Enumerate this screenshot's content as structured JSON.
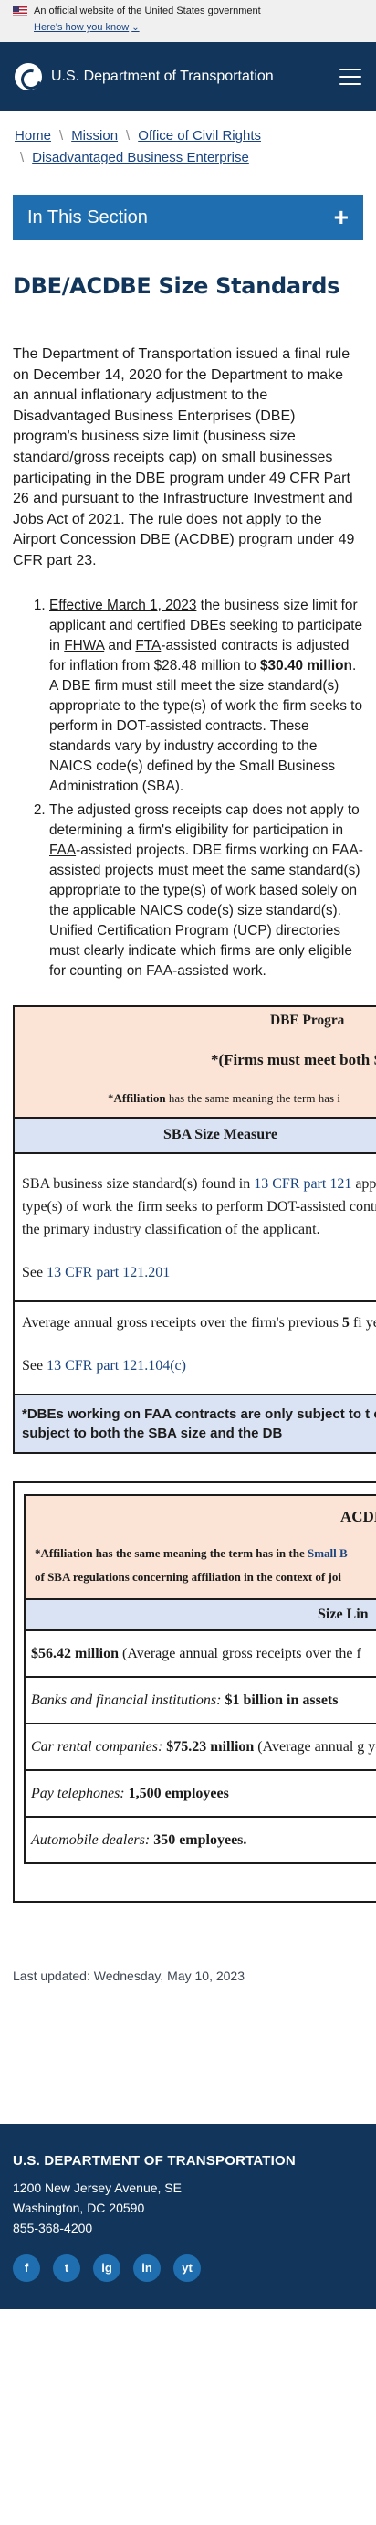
{
  "gov_banner": {
    "text": "An official website of the United States government",
    "link": "Here's how you know"
  },
  "header": {
    "agency": "U.S. Department of Transportation"
  },
  "breadcrumb": {
    "items": [
      "Home",
      "Mission",
      "Office of Civil Rights",
      "Disadvantaged Business Enterprise"
    ]
  },
  "section_nav": {
    "label": "In This Section",
    "toggle": "+"
  },
  "page": {
    "title": "DBE/ACDBE Size Standards",
    "intro": "The Department of Transportation issued a final rule on December 14, 2020 for the Department to make an annual inflationary adjustment to the Disadvantaged Business Enterprises (DBE) program's business size limit (business size standard/gross receipts cap) on small businesses participating in the DBE program under 49 CFR Part 26 and pursuant to the Infrastructure Investment and Jobs Act of 2021. The rule does not apply to the Airport Concession DBE (ACDBE) program under 49 CFR part 23."
  },
  "rules": {
    "item1": {
      "date_link": "Effective March 1, 2023",
      "t1": " the business size limit for applicant and certified DBEs seeking to participate in ",
      "fhwa": "FHWA",
      "t2": " and ",
      "fta": "FTA",
      "t3": "-assisted contracts is adjusted for inflation from $28.48 million to ",
      "amount": "$30.40 million",
      "t4": ". A DBE firm must still meet the size standard(s) appropriate to the type(s) of work the firm seeks to perform in DOT-assisted contracts. These standards vary by industry according to the NAICS code(s) defined by the Small Business Administration (SBA)."
    },
    "item2": {
      "t1": "The adjusted gross receipts cap does not apply to determining a firm's eligibility for participation in ",
      "faa": "FAA",
      "t2": "-assisted projects. DBE firms working on FAA-assisted projects must meet the same standard(s) appropriate to the type(s) of work based solely on the applicable NAICS code(s) size standard(s). Unified Certification Program (UCP) directories must clearly indicate which firms are only eligible for counting on FAA-assisted work."
    }
  },
  "dbe_table": {
    "title": "DBE Progra",
    "subtitle": "*(Firms must meet both S",
    "affiliation_star": "*",
    "affiliation_bold": "Affiliation",
    "affiliation_rest": " has the same meaning the term has i",
    "measure": "SBA Size Measure",
    "cell1_t1": "SBA business size standard(s) found in ",
    "cell1_link": "13 CFR part 121",
    "cell1_t2": " appropriate to the type(s) of work the firm seeks to perform DOT-assisted contracts, including the primary industry classification of the applicant.",
    "cell1_see": "See ",
    "cell1_see_link": "13 CFR part 121.201",
    "cell2_t1": "Average annual gross receipts over the firm's previous ",
    "cell2_bold": "5",
    "cell2_t2": " fi years.",
    "cell2_see": "See ",
    "cell2_see_link": "13 CFR part 121.104(c)",
    "footnote": "*DBEs working on FAA contracts are only subject to t contracts are subject to both the SBA size and the DB"
  },
  "acdbe_table": {
    "title": "ACDBE P",
    "aff_t1": "*Affiliation has the same meaning the term has in the ",
    "aff_link": "Small B",
    "aff_t2": "of SBA regulations concerning affiliation in the context of joi",
    "measure": "Size Lin",
    "rows": [
      {
        "amount": "$56.42 million",
        "rest": " (Average annual gross receipts over the f"
      },
      {
        "label": "Banks and financial institutions:",
        "amount": " $1 billion in assets"
      },
      {
        "label": "Car rental companies:",
        "amount": " $75.23 million",
        "rest": " (Average annual g years)."
      },
      {
        "label": "Pay telephones:",
        "amount": " 1,500 employees"
      },
      {
        "label": "Automobile dealers:",
        "amount": " 350 employees."
      }
    ]
  },
  "last_updated": "Last updated: Wednesday, May 10, 2023",
  "footer": {
    "org": "U.S. DEPARTMENT OF TRANSPORTATION",
    "address1": "1200 New Jersey Avenue, SE",
    "address2": "Washington, DC 20590",
    "phone": "855-368-4200",
    "socials": [
      "f",
      "t",
      "ig",
      "in",
      "yt"
    ]
  },
  "colors": {
    "navy": "#12365b",
    "accent": "#1f6eb0",
    "peach": "#fbe4d5",
    "light_blue": "#dae3f3",
    "link": "#1a4480"
  }
}
